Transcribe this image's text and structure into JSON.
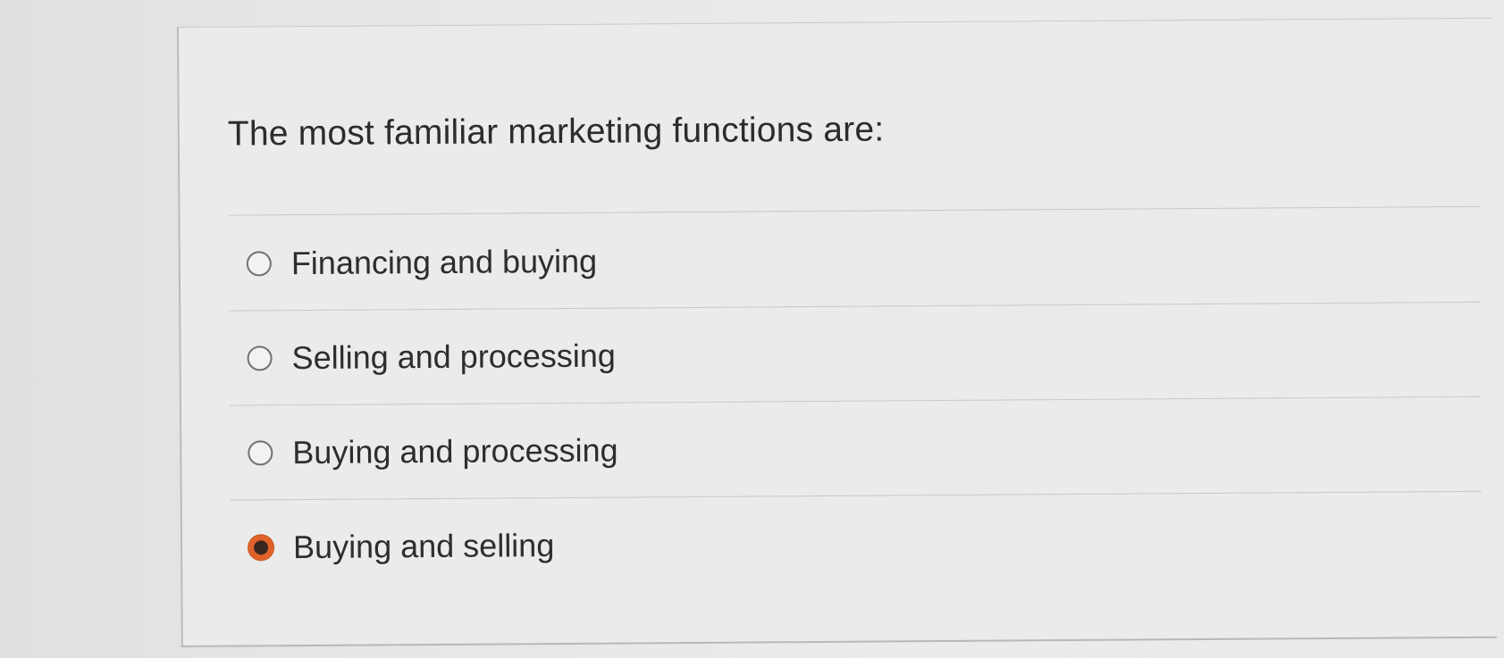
{
  "question": {
    "text": "The most familiar marketing functions are:"
  },
  "options": [
    {
      "label": "Financing and buying",
      "selected": false
    },
    {
      "label": "Selling and processing",
      "selected": false
    },
    {
      "label": "Buying and processing",
      "selected": false
    },
    {
      "label": "Buying and selling",
      "selected": true
    }
  ],
  "colors": {
    "selected_radio": "#e0622a",
    "background": "#e8e9e8"
  }
}
